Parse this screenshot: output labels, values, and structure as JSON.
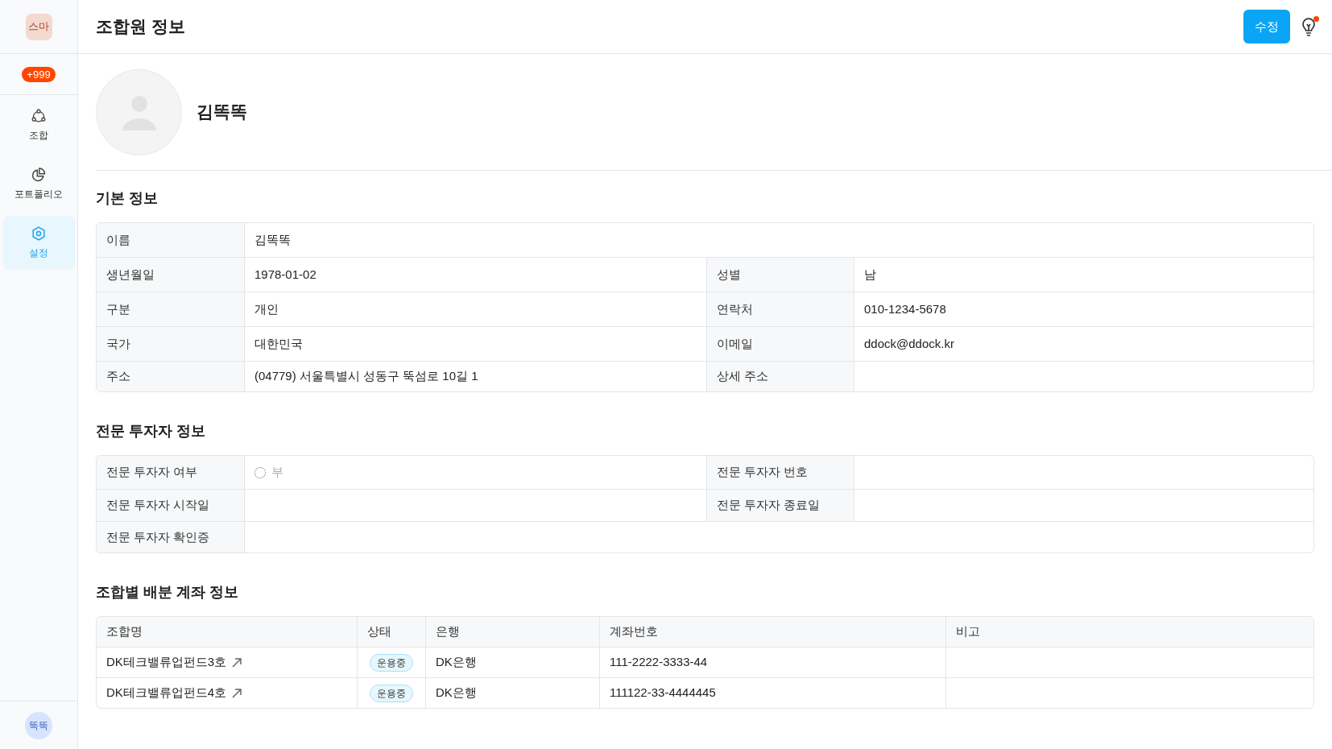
{
  "sidebar": {
    "logo": "스마",
    "badge": "+999",
    "items": [
      {
        "kind": "union",
        "label": "조합",
        "selected": false
      },
      {
        "kind": "portfolio",
        "label": "포트폴리오",
        "selected": false
      },
      {
        "kind": "settings",
        "label": "설정",
        "selected": true
      }
    ],
    "user": "똑똑"
  },
  "header": {
    "title": "조합원 정보",
    "edit_button": "수정",
    "tips_has_notification": true
  },
  "profile": {
    "name": "김똑똑"
  },
  "basic_info": {
    "title": "기본 정보",
    "rows": [
      [
        {
          "label": "이름",
          "value": "김똑똑"
        }
      ],
      [
        {
          "label": "생년월일",
          "value": "1978-01-02"
        },
        {
          "label": "성별",
          "value": "남"
        }
      ],
      [
        {
          "label": "구분",
          "value": "개인"
        },
        {
          "label": "연락처",
          "value": "010-1234-5678"
        }
      ],
      [
        {
          "label": "국가",
          "value": "대한민국"
        },
        {
          "label": "이메일",
          "value": "ddock@ddock.kr"
        }
      ],
      [
        {
          "label": "주소",
          "value": "(04779) 서울특별시 성동구 뚝섬로 10길 1"
        },
        {
          "label": "상세 주소"
        }
      ]
    ]
  },
  "pro_investor": {
    "title": "전문 투자자 정보",
    "rows": [
      [
        {
          "label": "전문 투자자 여부",
          "kind": "radio",
          "value": "부",
          "checked": false
        },
        {
          "label": "전문 투자자 번호"
        }
      ],
      [
        {
          "label": "전문 투자자 시작일"
        },
        {
          "label": "전문 투자자 종료일"
        }
      ],
      [
        {
          "label": "전문 투자자 확인증"
        }
      ]
    ]
  },
  "accounts": {
    "title": "조합별 배분 계좌 정보",
    "columns": [
      "조합명",
      "상태",
      "은행",
      "계좌번호",
      "비고"
    ],
    "rows": [
      {
        "fund": "DK테크밸류업펀드3호",
        "status": "운용중",
        "bank": "DK은행",
        "account": "111-2222-3333-44"
      },
      {
        "fund": "DK테크밸류업펀드4호",
        "status": "운용중",
        "bank": "DK은행",
        "account": "111122-33-4444445"
      }
    ]
  }
}
